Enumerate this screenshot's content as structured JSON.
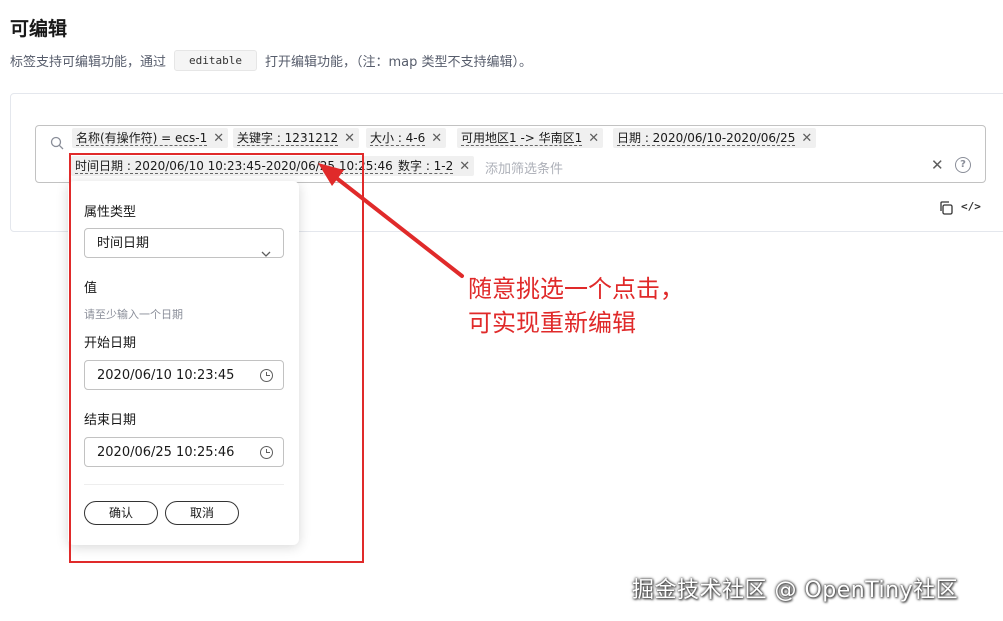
{
  "section": {
    "title": "可编辑",
    "desc_prefix": "标签支持可编辑功能，通过",
    "code": "editable",
    "desc_suffix": "打开编辑功能，（注：map 类型不支持编辑）。"
  },
  "search": {
    "tags": [
      {
        "text": "名称(有操作符) = ecs-1"
      },
      {
        "text": "关键字 : 1231212"
      },
      {
        "text": "大小 : 4-6"
      },
      {
        "text": "可用地区1 -> 华南区1"
      },
      {
        "text": "日期 : 2020/06/10-2020/06/25"
      },
      {
        "text": "时间日期 : 2020/06/10 10:23:45-2020/06/25 10:25:46"
      },
      {
        "text": "数字 : 1-2"
      }
    ],
    "placeholder": "添加筛选条件",
    "clear_icon": "close-icon",
    "help_icon": "help-circle-icon",
    "help_glyph": "?"
  },
  "toolbar": {
    "copy_icon": "copy-icon",
    "code_glyph": "</>"
  },
  "popover": {
    "type_label": "属性类型",
    "type_value": "时间日期",
    "value_label": "值",
    "hint": "请至少输入一个日期",
    "start_label": "开始日期",
    "start_value": "2020/06/10 10:23:45",
    "end_label": "结束日期",
    "end_value": "2020/06/25 10:25:46",
    "confirm": "确认",
    "cancel": "取消"
  },
  "annotation": {
    "line1": "随意挑选一个点击，",
    "line2": "可实现重新编辑",
    "color": "#e02a2a"
  },
  "watermark": "掘金技术社区 @ OpenTiny社区"
}
